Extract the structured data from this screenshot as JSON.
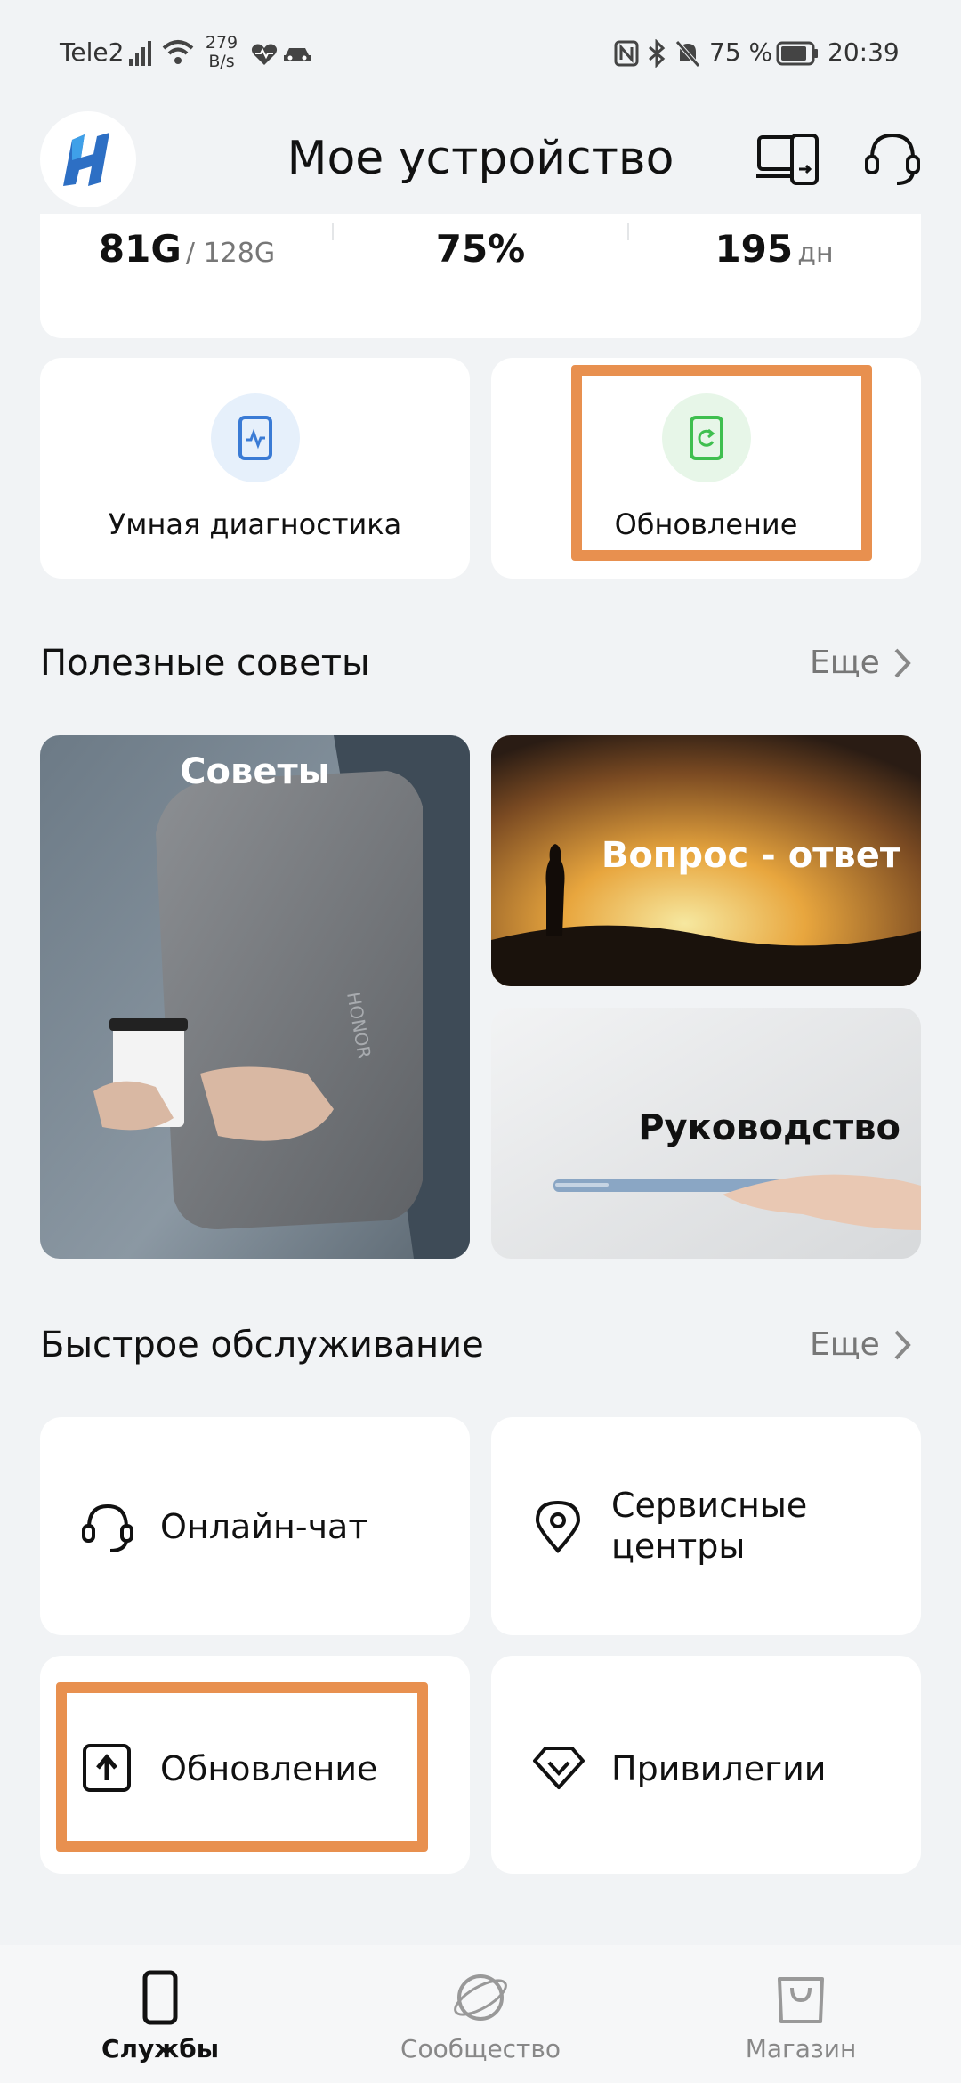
{
  "status_bar": {
    "carrier": "Tele2",
    "net_speed_value": "279",
    "net_speed_unit": "B/s",
    "battery_percent": "75 %",
    "time": "20:39"
  },
  "header": {
    "title": "Мое устройство",
    "left_icon": "honor-logo",
    "right_icons": [
      "device-switch-icon",
      "headset-icon"
    ]
  },
  "stats": {
    "storage_used": "81G",
    "storage_total": "/ 128G",
    "battery": "75%",
    "days": "195",
    "days_unit": "дн"
  },
  "tools": {
    "diagnostics_label": "Умная диагностика",
    "update_label": "Обновление"
  },
  "tips": {
    "title": "Полезные советы",
    "more": "Еще",
    "cards": {
      "advice": "Советы",
      "faq": "Вопрос - ответ",
      "manual": "Руководство"
    }
  },
  "quick_service": {
    "title": "Быстрое обслуживание",
    "more": "Еще",
    "online_chat": "Онлайн-чат",
    "service_centers": "Сервисные центры",
    "update": "Обновление",
    "privileges": "Привилегии"
  },
  "tabbar": {
    "services": "Службы",
    "community": "Сообщество",
    "store": "Магазин"
  },
  "colors": {
    "highlight": "#e8904f",
    "background": "#f1f3f5",
    "diag_icon": "#3a7bd5",
    "update_icon": "#3fbf4f"
  }
}
